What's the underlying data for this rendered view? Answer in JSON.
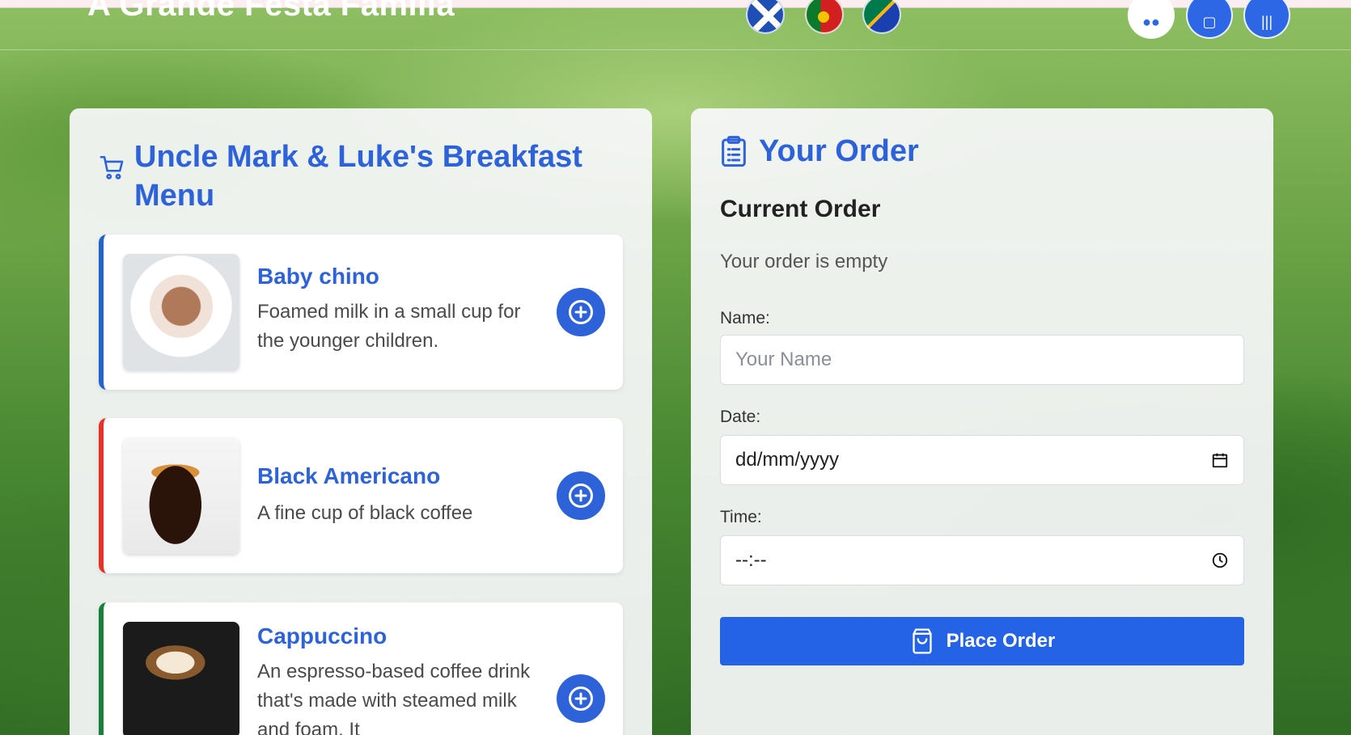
{
  "header": {
    "site_title": "A Grande Festa Familia"
  },
  "menu": {
    "title": "Uncle Mark & Luke's Breakfast Menu",
    "items": [
      {
        "name": "Baby chino",
        "description": "Foamed milk in a small cup for the younger children.",
        "accent": "#2563c9"
      },
      {
        "name": "Black Americano",
        "description": "A fine cup of black coffee",
        "accent": "#e53327"
      },
      {
        "name": "Cappuccino",
        "description": "An espresso-based coffee drink that's made with steamed milk and foam. It",
        "accent": "#1b7e3a"
      }
    ]
  },
  "order": {
    "title": "Your Order",
    "current_heading": "Current Order",
    "empty_text": "Your order is empty",
    "name_label": "Name:",
    "name_placeholder": "Your Name",
    "date_label": "Date:",
    "date_value": "dd/mm/yyyy",
    "time_label": "Time:",
    "time_value": "--:--",
    "place_button": "Place Order"
  },
  "colors": {
    "accent": "#2d62d9",
    "button": "#2563e6"
  }
}
